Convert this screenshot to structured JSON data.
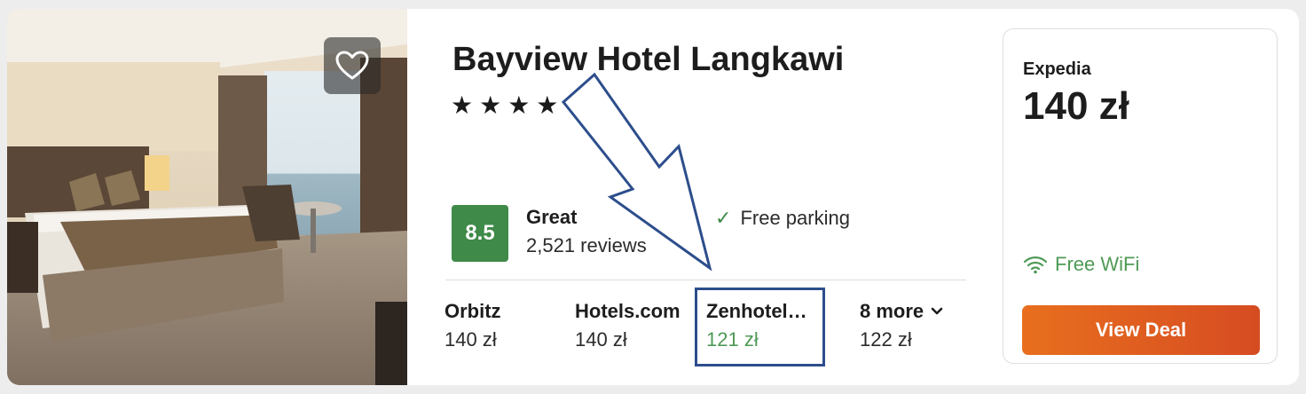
{
  "hotel": {
    "name": "Bayview Hotel Langkawi",
    "stars": "★★★★",
    "score": "8.5",
    "rating_word": "Great",
    "reviews": "2,521 reviews",
    "amenity": "Free parking"
  },
  "providers": [
    {
      "name": "Orbitz",
      "price": "140 zł"
    },
    {
      "name": "Hotels.com",
      "price": "140 zł"
    },
    {
      "name": "Zenhotel…",
      "price": "121 zł"
    },
    {
      "name": "8 more",
      "price": "122 zł"
    }
  ],
  "deal": {
    "provider": "Expedia",
    "price": "140 zł",
    "amenity": "Free WiFi",
    "button": "View Deal"
  },
  "colors": {
    "score_bg": "#3f8a48",
    "best_price": "#4f9a56",
    "deal_button": "#e0601f",
    "annotation": "#2d4e8c"
  },
  "icons": [
    "heart-icon",
    "check-icon",
    "wifi-icon",
    "chevron-down-icon"
  ]
}
